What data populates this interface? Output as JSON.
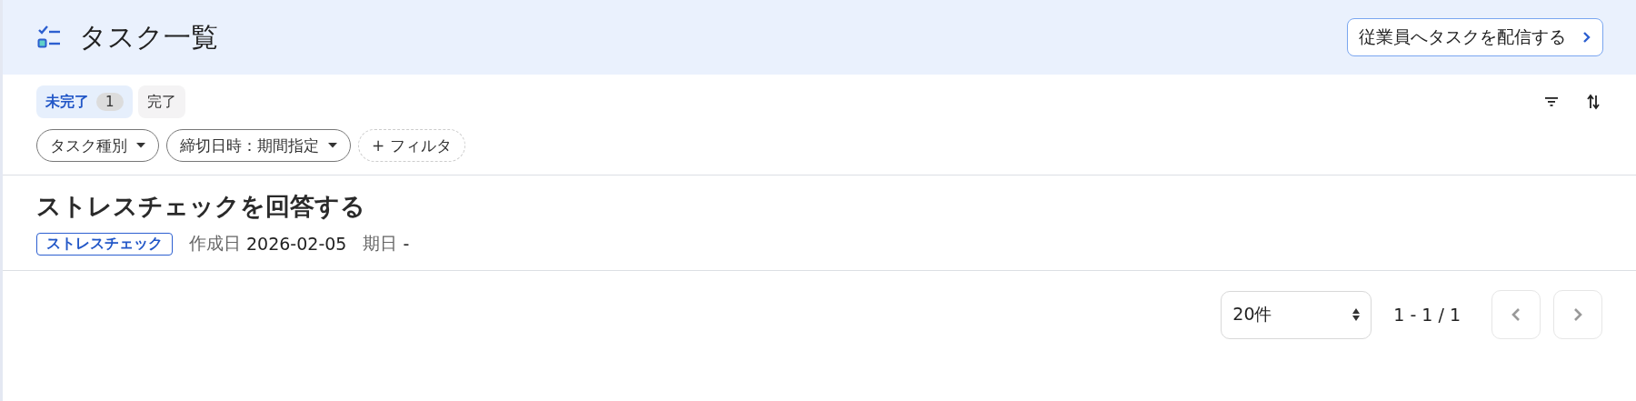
{
  "header": {
    "title": "タスク一覧",
    "action_button": "従業員へタスクを配信する"
  },
  "tabs": [
    {
      "label": "未完了",
      "count": "1",
      "selected": true
    },
    {
      "label": "完了",
      "selected": false
    }
  ],
  "filters": [
    {
      "kind": "dropdown",
      "label": "タスク種別"
    },
    {
      "kind": "dropdown",
      "label": "締切日時：期間指定"
    },
    {
      "kind": "add",
      "label": "+ フィルタ"
    }
  ],
  "tasks": [
    {
      "title": "ストレスチェックを回答する",
      "tag": "ストレスチェック",
      "created_label": "作成日",
      "created": "2026-02-05",
      "due_label": "期日",
      "due": "-"
    }
  ],
  "pagination": {
    "page_size": "20件",
    "range": "1 - 1 / 1",
    "prev_disabled": true,
    "next_disabled": true
  }
}
